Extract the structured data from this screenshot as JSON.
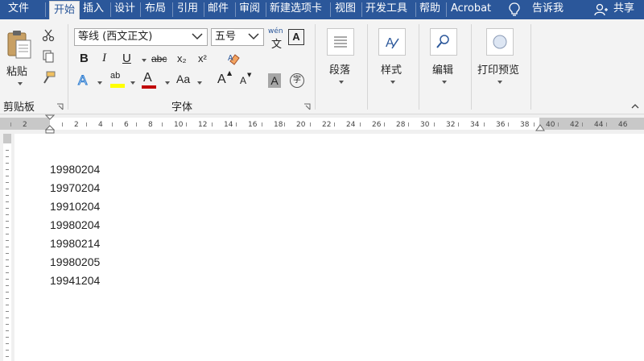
{
  "tabs": [
    {
      "label": "文件",
      "active": false
    },
    {
      "label": "开始",
      "active": true
    },
    {
      "label": "插入",
      "active": false
    },
    {
      "label": "设计",
      "active": false
    },
    {
      "label": "布局",
      "active": false
    },
    {
      "label": "引用",
      "active": false
    },
    {
      "label": "邮件",
      "active": false
    },
    {
      "label": "审阅",
      "active": false
    },
    {
      "label": "新建选项卡",
      "active": false
    },
    {
      "label": "视图",
      "active": false
    },
    {
      "label": "开发工具",
      "active": false
    },
    {
      "label": "帮助",
      "active": false
    },
    {
      "label": "Acrobat",
      "active": false
    }
  ],
  "tell_me": "告诉我",
  "share": "共享",
  "clipboard": {
    "paste_label": "粘贴",
    "group_label": "剪贴板"
  },
  "font": {
    "font_name": "等线 (西文正文)",
    "font_size": "五号",
    "phonetic_guide": "wén",
    "phonetic_char": "文",
    "char_border": "A",
    "bold": "B",
    "italic": "I",
    "underline": "U",
    "strikethrough": "abc",
    "subscript": "x₂",
    "superscript": "x²",
    "text_effects": "A",
    "highlight": "ab",
    "font_color": "A",
    "change_case": "Aa",
    "grow": "A",
    "shrink": "A",
    "char_shading": "A",
    "enclose": "字",
    "group_label": "字体"
  },
  "paragraph_label": "段落",
  "styles_label": "样式",
  "editing_label": "编辑",
  "print_preview_label": "打印预览",
  "ruler_numbers": [
    "2",
    "2",
    "4",
    "6",
    "8",
    "10",
    "12",
    "14",
    "16",
    "18",
    "20",
    "22",
    "24",
    "26",
    "28",
    "30",
    "32",
    "34",
    "36",
    "38",
    "40",
    "42",
    "44",
    "46"
  ],
  "document": {
    "lines": [
      "19980204",
      "19970204",
      "19910204",
      "19980204",
      "19980214",
      "19980205",
      "19941204"
    ]
  },
  "colors": {
    "accent": "#2b579a",
    "ribbon_bg": "#f3f3f3",
    "highlight": "#ffff00",
    "font_color_bar": "#c00000"
  }
}
